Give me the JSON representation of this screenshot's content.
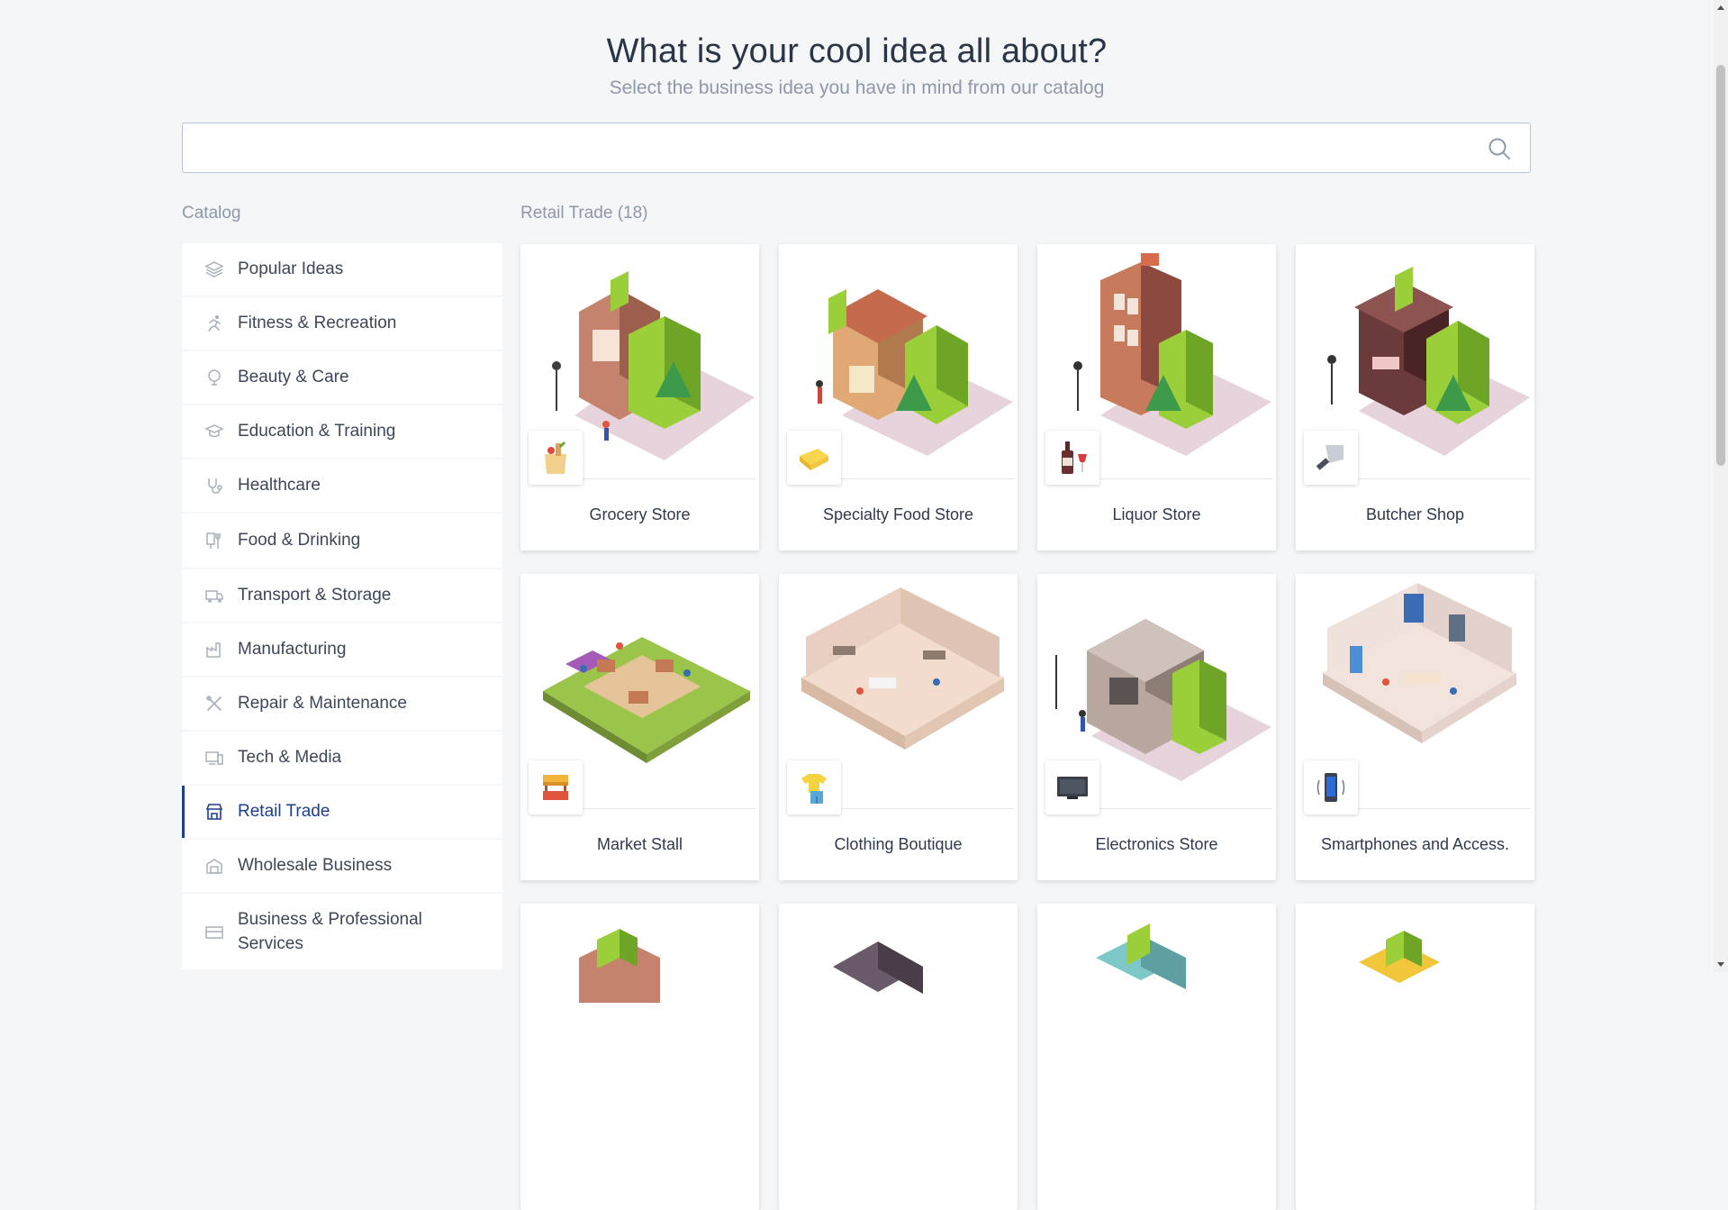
{
  "header": {
    "title": "What is your cool idea all about?",
    "subtitle": "Select the business idea you have in mind from our catalog"
  },
  "search": {
    "value": "",
    "placeholder": "",
    "icon": "search-icon"
  },
  "catalog_label": "Catalog",
  "category_heading": "Retail Trade (18)",
  "sidebar": {
    "items": [
      {
        "label": "Popular Ideas",
        "icon": "layers-icon"
      },
      {
        "label": "Fitness & Recreation",
        "icon": "runner-icon"
      },
      {
        "label": "Beauty & Care",
        "icon": "mirror-icon"
      },
      {
        "label": "Education & Training",
        "icon": "graduation-cap-icon"
      },
      {
        "label": "Healthcare",
        "icon": "stethoscope-icon"
      },
      {
        "label": "Food & Drinking",
        "icon": "cutlery-icon"
      },
      {
        "label": "Transport & Storage",
        "icon": "truck-icon"
      },
      {
        "label": "Manufacturing",
        "icon": "factory-icon"
      },
      {
        "label": "Repair & Maintenance",
        "icon": "tools-icon"
      },
      {
        "label": "Tech & Media",
        "icon": "devices-icon"
      },
      {
        "label": "Retail Trade",
        "icon": "storefront-icon",
        "active": true
      },
      {
        "label": "Wholesale Business",
        "icon": "warehouse-icon"
      },
      {
        "label": "Business & Professional Services",
        "icon": "briefcase-icon"
      }
    ]
  },
  "cards": [
    {
      "label": "Grocery Store",
      "icon": "grocery-bag-icon"
    },
    {
      "label": "Specialty Food Store",
      "icon": "cheese-icon"
    },
    {
      "label": "Liquor Store",
      "icon": "wine-bottle-icon"
    },
    {
      "label": "Butcher Shop",
      "icon": "cleaver-icon"
    },
    {
      "label": "Market Stall",
      "icon": "market-stall-icon"
    },
    {
      "label": "Clothing Boutique",
      "icon": "clothing-icon"
    },
    {
      "label": "Electronics Store",
      "icon": "tv-icon"
    },
    {
      "label": "Smartphones and Access.",
      "icon": "smartphone-icon"
    },
    {
      "label": "",
      "icon": ""
    },
    {
      "label": "",
      "icon": ""
    },
    {
      "label": "",
      "icon": ""
    },
    {
      "label": "",
      "icon": ""
    }
  ],
  "colors": {
    "accent": "#1d3f8c",
    "background": "#f4f6f8",
    "building_green": "#9bcf3a",
    "building_shadow": "#c9a7b6"
  }
}
